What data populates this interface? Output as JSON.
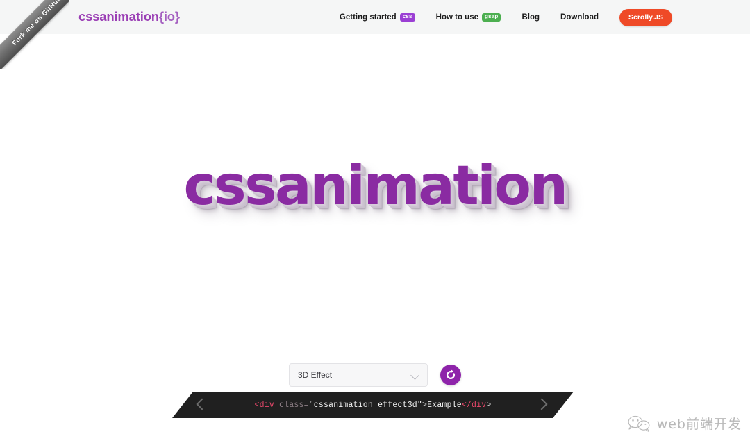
{
  "ribbon": {
    "label": "Fork me on GitHub",
    "icon": "github-ribbon-icon"
  },
  "header": {
    "brand_main": "cssanimation",
    "brand_braces": "{io}",
    "nav": [
      {
        "label": "Getting started",
        "badge": "css",
        "badge_color": "#9b3fd4"
      },
      {
        "label": "How to use",
        "badge": "gsap",
        "badge_color": "#4caf50"
      },
      {
        "label": "Blog",
        "badge": null,
        "badge_color": null
      },
      {
        "label": "Download",
        "badge": null,
        "badge_color": null
      }
    ],
    "cta": {
      "label": "Scrolly.JS",
      "color": "#ef4a27"
    }
  },
  "hero": {
    "text": "cssanimation",
    "color": "#8a2ba2",
    "effect": "3d-extrude-shadow"
  },
  "controls": {
    "effect_select": {
      "value": "3D Effect",
      "icon": "chevron-down-icon",
      "options": [
        "3D Effect"
      ]
    },
    "refresh": {
      "icon": "refresh-icon",
      "color": "#8e24aa",
      "label": ""
    }
  },
  "codebar": {
    "prev_icon": "chevron-left-icon",
    "next_icon": "chevron-right-icon",
    "code": {
      "open_lt": "<",
      "open_tag": "div",
      "attr_name": "class",
      "equals": "=",
      "attr_value": "\"cssanimation effect3d\"",
      "open_gt": ">",
      "content": " Example ",
      "close_lt": "</",
      "close_tag": "div",
      "close_gt": ">"
    },
    "full_text": "<div class=\"cssanimation effect3d\"> Example </div>"
  },
  "watermark": {
    "text": "web前端开发",
    "icon": "wechat-smiley-icon"
  }
}
